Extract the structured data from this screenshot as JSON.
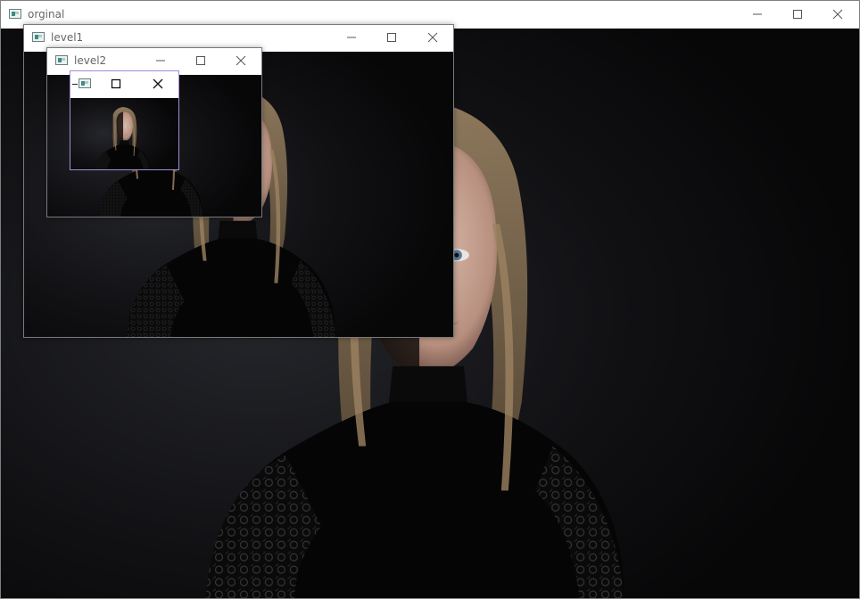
{
  "windows": {
    "original": {
      "title": "orginal"
    },
    "level1": {
      "title": "level1"
    },
    "level2": {
      "title": "level2"
    },
    "level3": {
      "title": ""
    }
  },
  "controls": {
    "minimize_icon": "minimize-icon",
    "maximize_icon": "maximize-icon",
    "close_icon": "close-icon"
  },
  "image": {
    "subject": "portrait",
    "background_color": "#0d0d0e",
    "clothing_color": "#050505",
    "skin_color": "#c9a89a",
    "hair_color": "#8a7456"
  }
}
